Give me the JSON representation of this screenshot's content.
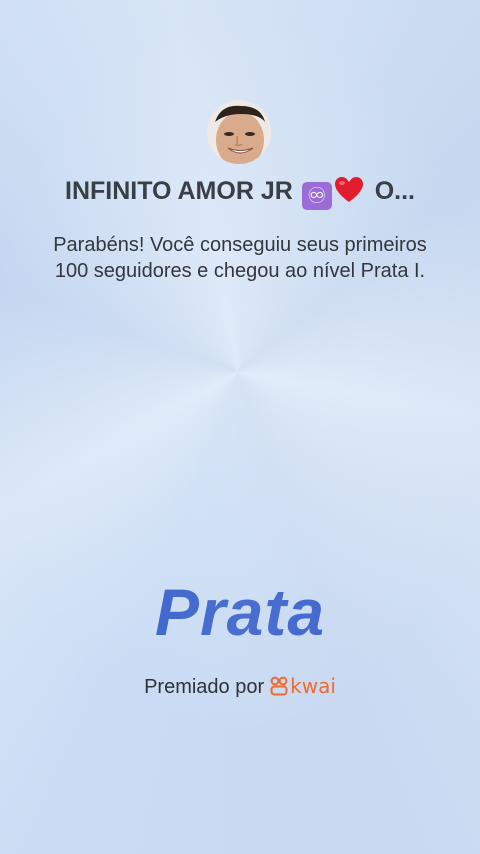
{
  "user": {
    "name_prefix": "INFINITO AMOR JR",
    "name_suffix": "O...",
    "emoji_infinity": "♾",
    "avatar_icon": "user-photo"
  },
  "message": "Parabéns! Você conseguiu seus primeiros 100 seguidores e chegou ao nível Prata I.",
  "level_label": "Prata",
  "awarded_by": {
    "text": "Premiado por",
    "brand": "kwai",
    "brand_color": "#f26a2e"
  },
  "colors": {
    "level_blue": "#3f63c6",
    "background": "#c9dcf4",
    "infinity_badge": "#9b6cd8",
    "heart": "#e11d2e"
  }
}
